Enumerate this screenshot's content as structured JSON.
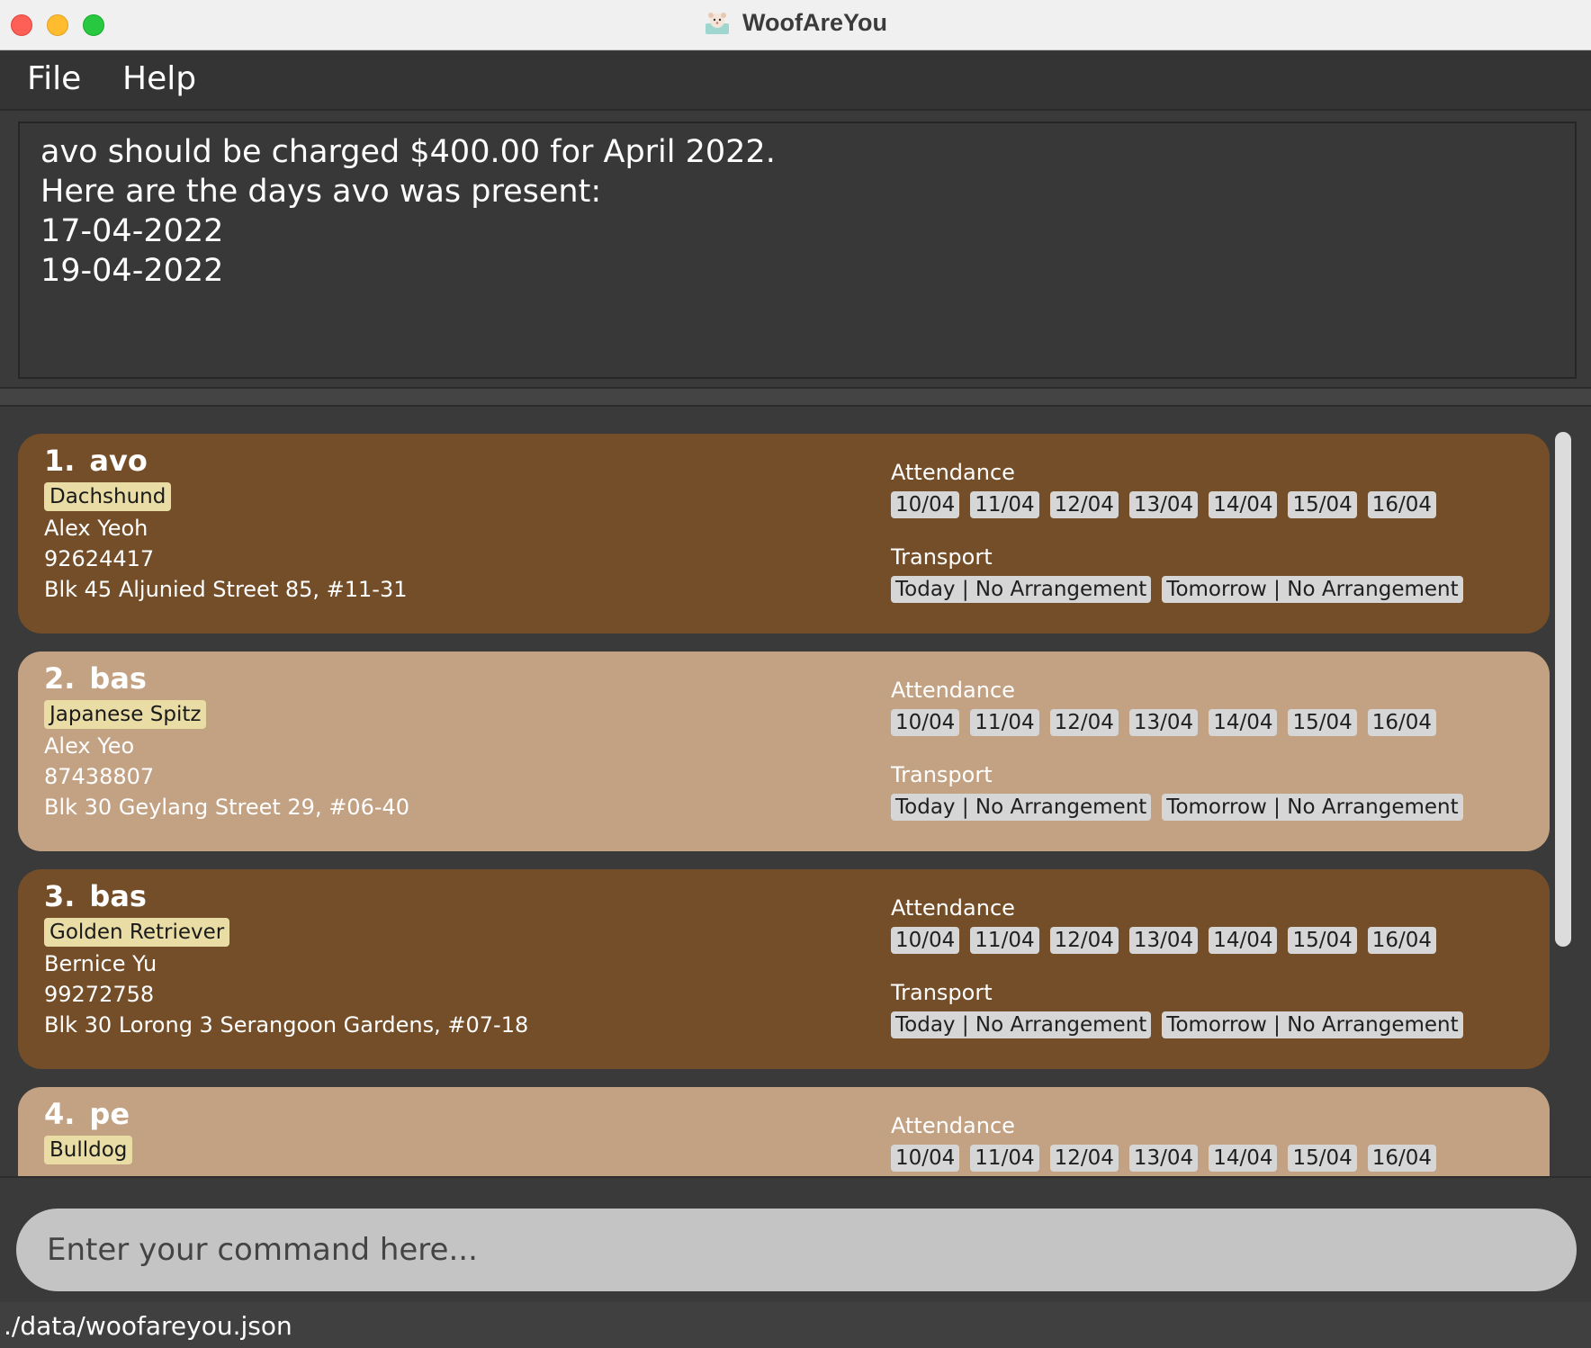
{
  "window": {
    "title": "WoofAreYou"
  },
  "menu": {
    "file": "File",
    "help": "Help"
  },
  "result": {
    "lines": [
      "avo should be charged $400.00 for April 2022.",
      "Here are the days avo was present:",
      "17-04-2022",
      "19-04-2022"
    ]
  },
  "labels": {
    "attendance": "Attendance",
    "transport": "Transport"
  },
  "pets": [
    {
      "index": "1.",
      "name": "avo",
      "breed": "Dachshund",
      "owner": "Alex Yeoh",
      "phone": "92624417",
      "address": "Blk 45 Aljunied Street 85, #11-31",
      "attendance": [
        "10/04",
        "11/04",
        "12/04",
        "13/04",
        "14/04",
        "15/04",
        "16/04"
      ],
      "transport": [
        "Today | No Arrangement",
        "Tomorrow | No Arrangement"
      ]
    },
    {
      "index": "2.",
      "name": "bas",
      "breed": "Japanese Spitz",
      "owner": "Alex Yeo",
      "phone": "87438807",
      "address": "Blk 30 Geylang Street 29, #06-40",
      "attendance": [
        "10/04",
        "11/04",
        "12/04",
        "13/04",
        "14/04",
        "15/04",
        "16/04"
      ],
      "transport": [
        "Today | No Arrangement",
        "Tomorrow | No Arrangement"
      ]
    },
    {
      "index": "3.",
      "name": "bas",
      "breed": "Golden Retriever",
      "owner": "Bernice Yu",
      "phone": "99272758",
      "address": "Blk 30 Lorong 3 Serangoon Gardens, #07-18",
      "attendance": [
        "10/04",
        "11/04",
        "12/04",
        "13/04",
        "14/04",
        "15/04",
        "16/04"
      ],
      "transport": [
        "Today | No Arrangement",
        "Tomorrow | No Arrangement"
      ]
    },
    {
      "index": "4.",
      "name": "pe",
      "breed": "Bulldog",
      "attendance": [
        "10/04",
        "11/04",
        "12/04",
        "13/04",
        "14/04",
        "15/04",
        "16/04"
      ]
    }
  ],
  "command": {
    "placeholder": "Enter your command here..."
  },
  "status": {
    "path": "./data/woofareyou.json"
  },
  "colors": {
    "card_dark": "#744e28",
    "card_light": "#c3a283",
    "breed_tag": "#e9dda5",
    "chip": "#d6d6d6"
  }
}
